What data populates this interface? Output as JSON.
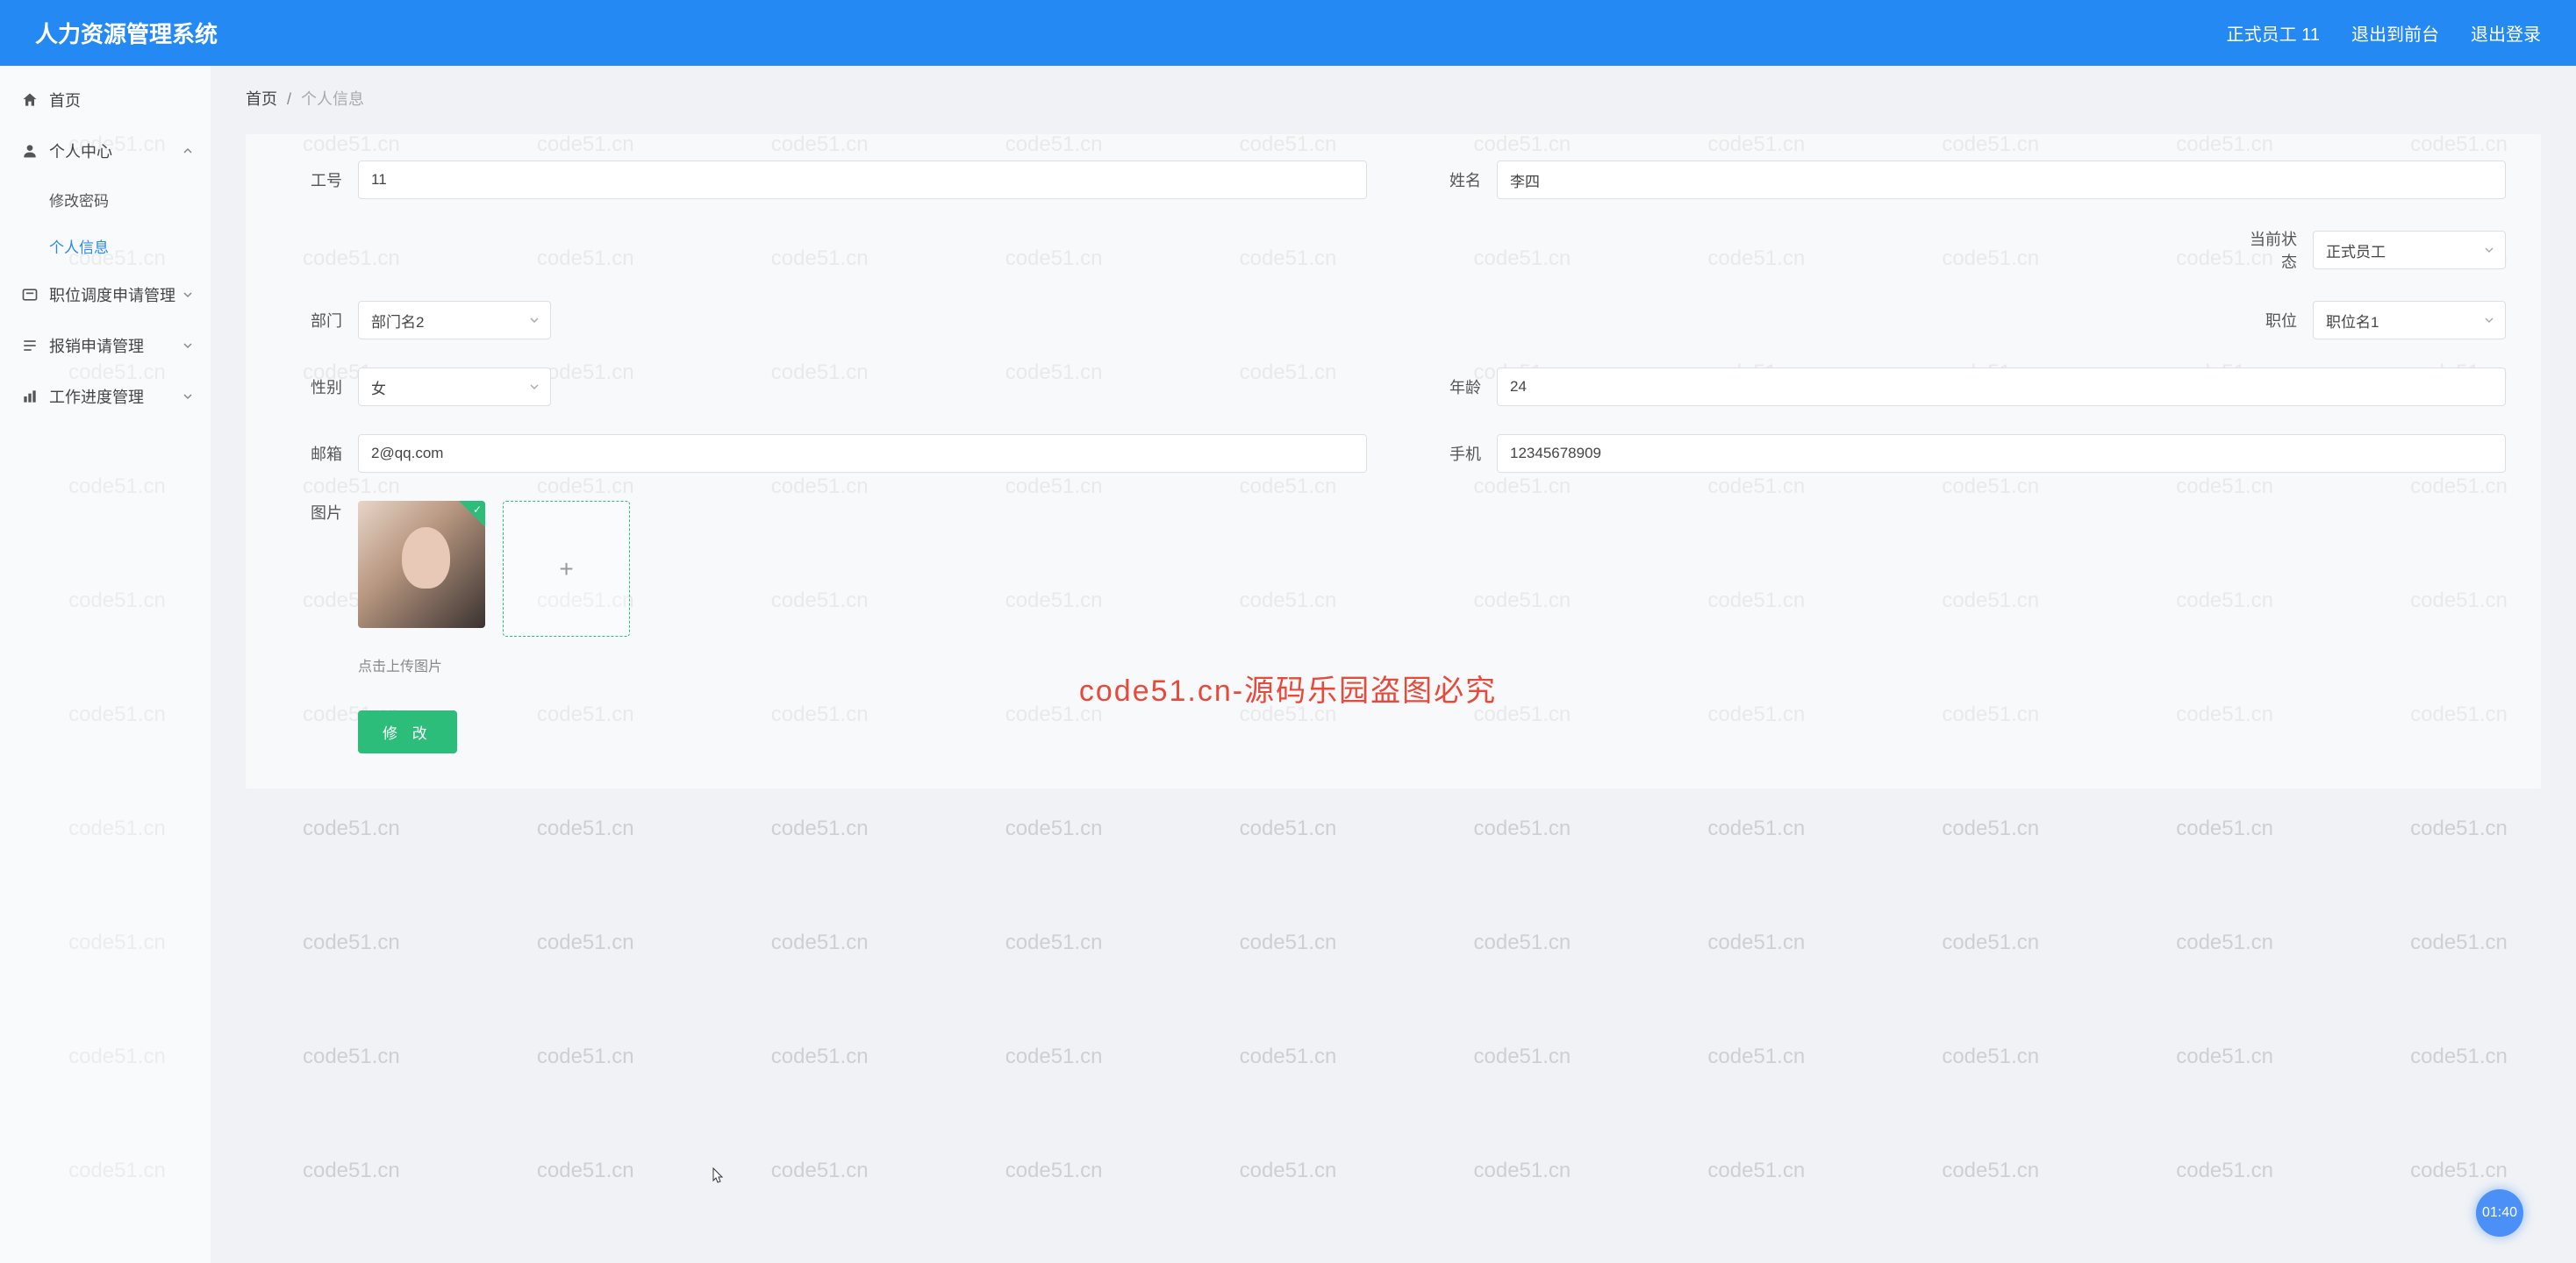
{
  "header": {
    "title": "人力资源管理系统",
    "user_status": "正式员工 11",
    "exit_front": "退出到前台",
    "logout": "退出登录"
  },
  "sidebar": {
    "home": "首页",
    "personal_center": "个人中心",
    "change_password": "修改密码",
    "personal_info": "个人信息",
    "position_transfer": "职位调度申请管理",
    "reimbursement": "报销申请管理",
    "work_progress": "工作进度管理"
  },
  "breadcrumb": {
    "home": "首页",
    "sep": "/",
    "current": "个人信息"
  },
  "form": {
    "emp_id_label": "工号",
    "emp_id_value": "11",
    "name_label": "姓名",
    "name_value": "李四",
    "status_label": "当前状态",
    "status_value": "正式员工",
    "dept_label": "部门",
    "dept_value": "部门名2",
    "position_label": "职位",
    "position_value": "职位名1",
    "gender_label": "性别",
    "gender_value": "女",
    "age_label": "年龄",
    "age_value": "24",
    "email_label": "邮箱",
    "email_value": "2@qq.com",
    "phone_label": "手机",
    "phone_value": "12345678909",
    "image_label": "图片",
    "upload_hint": "点击上传图片",
    "submit": "修 改"
  },
  "watermark": {
    "repeat": "code51.cn",
    "center": "code51.cn-源码乐园盗图必究"
  },
  "timer": "01:40"
}
